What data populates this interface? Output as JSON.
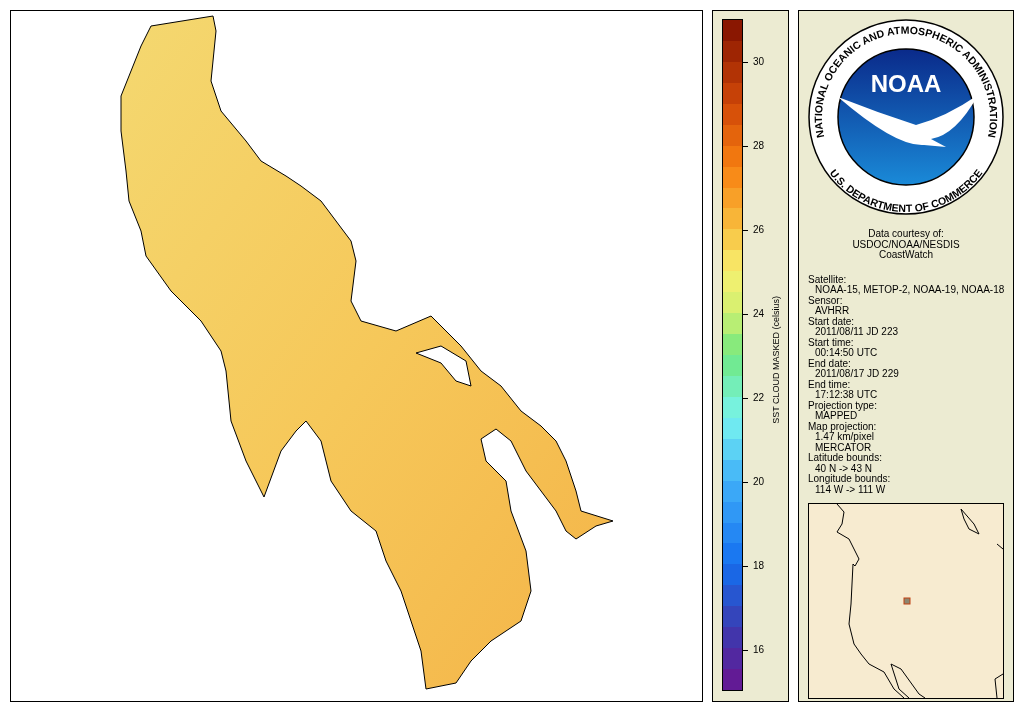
{
  "colorbar": {
    "label": "SST CLOUD MASKED (celsius)",
    "ticks": [
      "30",
      "28",
      "26",
      "24",
      "22",
      "20",
      "18",
      "16"
    ]
  },
  "logo": {
    "ring_top": "NATIONAL OCEANIC AND ATMOSPHERIC ADMINISTRATION",
    "ring_bottom": "U.S. DEPARTMENT OF COMMERCE",
    "center": "NOAA"
  },
  "credit": [
    "Data courtesy of:",
    "USDOC/NOAA/NESDIS",
    "CoastWatch"
  ],
  "fields": [
    {
      "label": "Satellite:",
      "values": [
        "NOAA-15, METOP-2, NOAA-19, NOAA-18"
      ]
    },
    {
      "label": "Sensor:",
      "values": [
        "AVHRR"
      ]
    },
    {
      "label": "Start date:",
      "values": [
        "2011/08/11 JD 223"
      ]
    },
    {
      "label": "Start time:",
      "values": [
        "00:14:50 UTC"
      ]
    },
    {
      "label": "End date:",
      "values": [
        "2011/08/17 JD 229"
      ]
    },
    {
      "label": "End time:",
      "values": [
        "17:12:38 UTC"
      ]
    },
    {
      "label": "Projection type:",
      "values": [
        "MAPPED"
      ]
    },
    {
      "label": "Map projection:",
      "values": [
        "1.47 km/pixel",
        "MERCATOR"
      ]
    },
    {
      "label": "Latitude bounds:",
      "values": [
        "40 N -> 43 N"
      ]
    },
    {
      "label": "Longitude bounds:",
      "values": [
        "114 W -> 111 W"
      ]
    }
  ]
}
